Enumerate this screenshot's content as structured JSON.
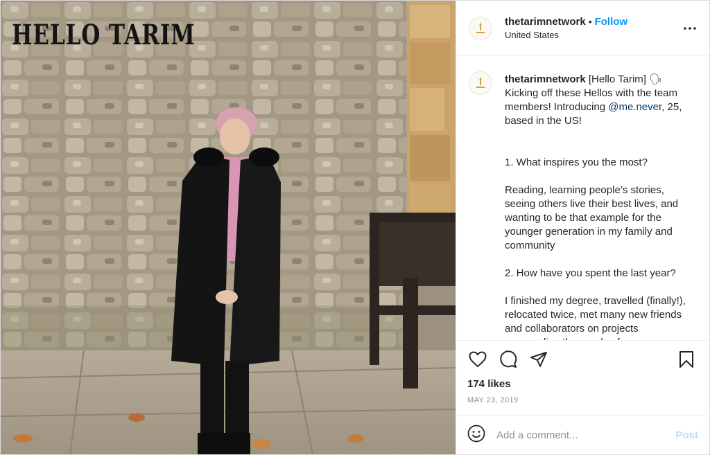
{
  "photo": {
    "overlay_text": "HELLO TARIM"
  },
  "header": {
    "username": "thetarimnetwork",
    "separator": "•",
    "follow_label": "Follow",
    "location": "United States",
    "more_icon": "more-horizontal-icon",
    "avatar_icon": "tarim-logo"
  },
  "caption": {
    "username": "thetarimnetwork",
    "intro": " [Hello Tarim] 🗣 Kicking off these Hellos with the team members! Introducing ",
    "mention": "@me.never",
    "intro_end": ", 25, based in the US!",
    "q1": "1. What inspires you the most?",
    "a1": "Reading, learning people’s stories, seeing others live their best lives, and wanting to be that example for the younger generation in my family and community",
    "q2": "2. How have you spent the last year?",
    "a2": "I finished my degree, travelled (finally!), relocated twice, met many new friends and collaborators on projects surrounding the needs of"
  },
  "actions": {
    "like_icon": "heart-icon",
    "comment_icon": "comment-icon",
    "share_icon": "share-icon",
    "save_icon": "bookmark-icon",
    "likes": "174 likes",
    "date": "MAY 23, 2019"
  },
  "comment_box": {
    "emoji_icon": "emoji-icon",
    "placeholder": "Add a comment...",
    "post_label": "Post"
  },
  "colors": {
    "link_blue": "#0095f6",
    "mention_blue": "#00376b",
    "post_disabled": "#b2dffc"
  }
}
